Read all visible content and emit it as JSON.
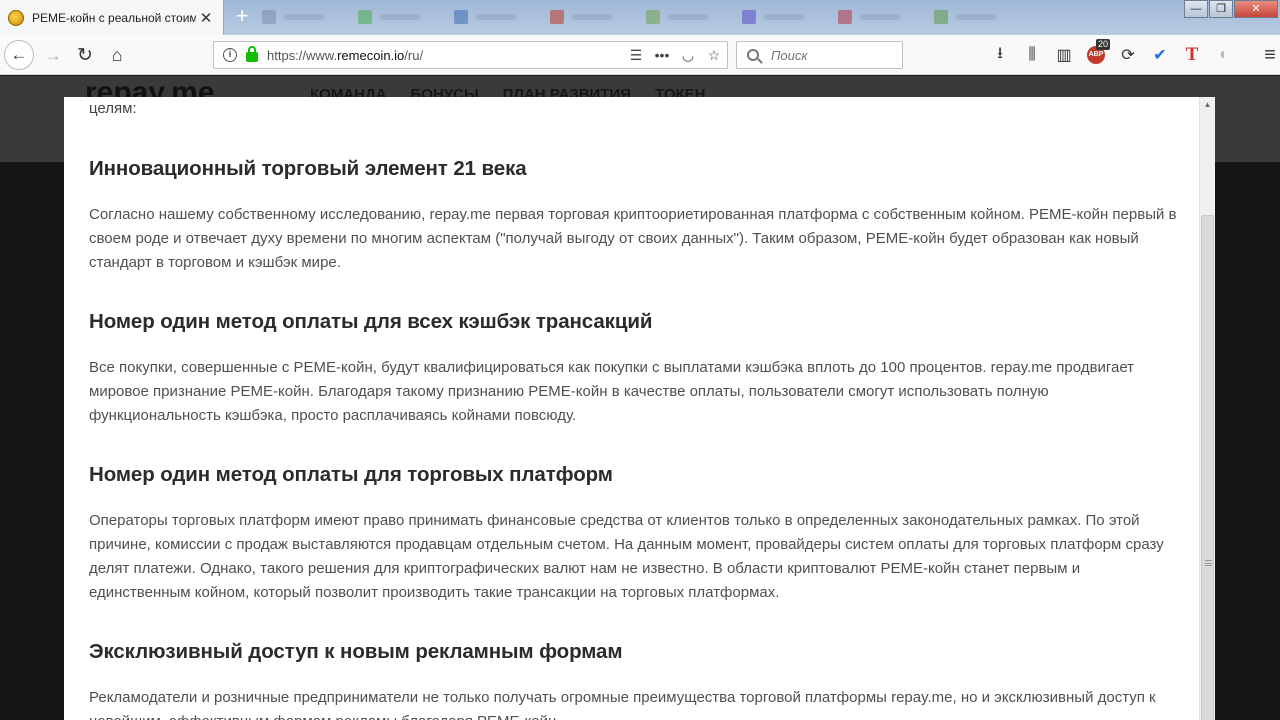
{
  "browser": {
    "tab": {
      "title": "РЕМЕ-койн с реальной стоим",
      "close_glyph": "✕"
    },
    "new_tab_glyph": "+",
    "window_controls": {
      "minimize": "—",
      "maximize": "❐",
      "close": "✕"
    },
    "nav": {
      "back_glyph": "←",
      "forward_glyph": "→",
      "reload_glyph": "↻",
      "home_glyph": "⌂"
    },
    "url": {
      "scheme": "https://www.",
      "host": "remecoin.io",
      "path": "/ru/"
    },
    "url_icons": {
      "reader": "☰",
      "more": "•••",
      "pocket": "◡",
      "star": "☆"
    },
    "search": {
      "placeholder": "Поиск"
    },
    "toolbar": {
      "download": "⭳",
      "library": "⫼",
      "sidebar": "▥",
      "adblock": "ABP",
      "adblock_badge": "20",
      "sync": "⟳",
      "vpn": "✔",
      "translate": "T",
      "ext": "◐",
      "menu": "≡"
    }
  },
  "site": {
    "logo": "repay.me",
    "nav": [
      "КОМАНДА",
      "БОНУСЫ",
      "ПЛАН РАЗВИТИЯ",
      "ТОКЕН"
    ]
  },
  "modal": {
    "fragment": "целям:",
    "sections": [
      {
        "title": "Инновационный торговый элемент 21 века",
        "body": "Согласно нашему собственному исследованию, repay.me первая торговая криптоориетированная платформа с собственным койном. РЕМЕ-койн первый в своем роде и отвечает духу времени по многим аспектам (\"получай выгоду от своих данных\"). Таким образом, РЕМЕ-койн будет образован как новый стандарт в торговом и кэшбэк мире."
      },
      {
        "title": "Номер один метод оплаты для всех кэшбэк трансакций",
        "body": "Все покупки, совершенные с РЕМЕ-койн, будут квалифицироваться как покупки с выплатами кэшбэка вплоть до 100 процентов. repay.me продвигает мировое признание РЕМЕ-койн. Благодаря такому признанию РЕМЕ-койн в качестве оплаты, пользователи смогут использовать полную функциональность кэшбэка, просто расплачиваясь койнами повсюду."
      },
      {
        "title": "Номер один метод оплаты для торговых платформ",
        "body": "Операторы торговых платформ имеют право принимать финансовые средства от клиентов только в определенных законодательных рамках. По этой причине, комиссии с продаж выставляются продавцам отдельным счетом. На данным момент, провайдеры систем оплаты для торговых платформ сразу делят платежи. Однако, такого решения для криптографических валют нам не известно. В области криптовалют РЕМЕ-койн станет первым и единственным койном, который позволит производить такие трансакции на торговых платформах."
      },
      {
        "title": "Эксклюзивный доступ к новым рекламным формам",
        "body": "Рекламодатели и розничные предприниматели не только получать огромные преимущества торговой платформы repay.me, но и эксклюзивный доступ к новейшим, эффективным формам рекламы благодаря РЕМЕ-койн."
      }
    ]
  }
}
